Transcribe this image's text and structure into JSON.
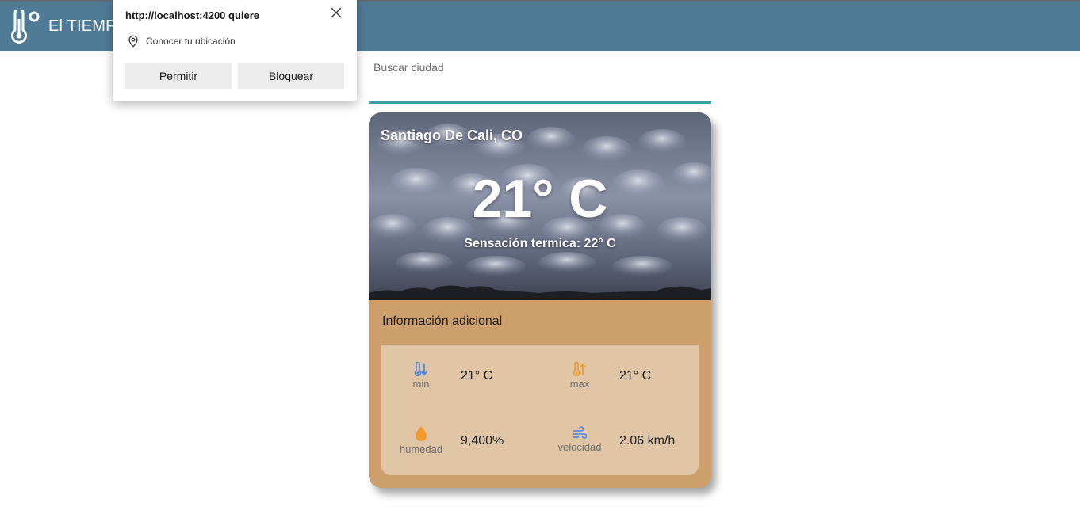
{
  "app": {
    "title": "El TIEMPO"
  },
  "search": {
    "label": "Buscar ciudad",
    "value": ""
  },
  "weather": {
    "city": "Santiago De Cali, CO",
    "temperature": "21° C",
    "feels_like": "Sensación termica: 22° C"
  },
  "info": {
    "title": "Información adicional",
    "stats": [
      {
        "icon": "thermometer-down-icon",
        "label": "min",
        "value": "21° C"
      },
      {
        "icon": "thermometer-up-icon",
        "label": "max",
        "value": "21° C"
      },
      {
        "icon": "water-drop-icon",
        "label": "humedad",
        "value": "9,400%"
      },
      {
        "icon": "wind-icon",
        "label": "velocidad",
        "value": "2.06 km/h"
      }
    ]
  },
  "permission_prompt": {
    "title": "http://localhost:4200 quiere",
    "request": "Conocer tu ubicación",
    "allow_label": "Permitir",
    "block_label": "Bloquear"
  },
  "colors": {
    "toolbar": "#4f7b96",
    "card": "#cc9f6d",
    "info_box": "#e0c5a7",
    "accent": "#3a9fa6",
    "icon_blue": "#4a86e8",
    "icon_orange": "#f19a2e"
  }
}
